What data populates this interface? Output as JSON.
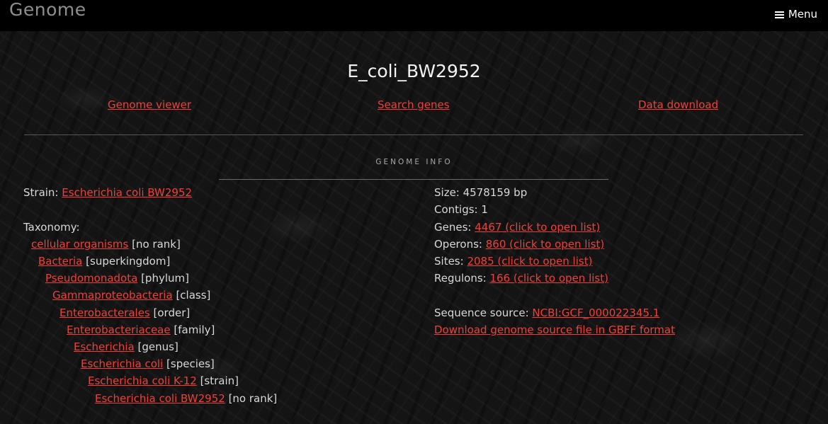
{
  "header": {
    "brand": "Genome",
    "menu_label": "Menu"
  },
  "title": "E_coli_BW2952",
  "nav": {
    "genome_viewer": "Genome viewer",
    "search_genes": "Search genes",
    "data_download": "Data download"
  },
  "section_label": "GENOME INFO",
  "strain": {
    "label": "Strain:",
    "value": "Escherichia coli BW2952"
  },
  "taxonomy": {
    "label": "Taxonomy:",
    "items": [
      {
        "name": "cellular organisms",
        "rank": "[no rank]"
      },
      {
        "name": "Bacteria",
        "rank": "[superkingdom]"
      },
      {
        "name": "Pseudomonadota",
        "rank": "[phylum]"
      },
      {
        "name": "Gammaproteobacteria",
        "rank": "[class]"
      },
      {
        "name": "Enterobacterales",
        "rank": "[order]"
      },
      {
        "name": "Enterobacteriaceae",
        "rank": "[family]"
      },
      {
        "name": "Escherichia",
        "rank": "[genus]"
      },
      {
        "name": "Escherichia coli",
        "rank": "[species]"
      },
      {
        "name": "Escherichia coli K-12",
        "rank": "[strain]"
      },
      {
        "name": "Escherichia coli BW2952",
        "rank": "[no rank]"
      }
    ]
  },
  "stats": {
    "size": "Size: 4578159 bp",
    "contigs": "Contigs: 1",
    "genes_label": "Genes:",
    "genes_link": "4467 (click to open list)",
    "operons_label": "Operons:",
    "operons_link": "860 (click to open list)",
    "sites_label": "Sites:",
    "sites_link": "2085 (click to open list)",
    "regulons_label": "Regulons:",
    "regulons_link": "166 (click to open list)"
  },
  "source": {
    "label": "Sequence source:",
    "link": "NCBI:GCF_000022345.1",
    "download": "Download genome source file in GBFF format"
  },
  "colors": {
    "link": "#ee4038",
    "background": "#141414",
    "topbar": "#000000"
  }
}
